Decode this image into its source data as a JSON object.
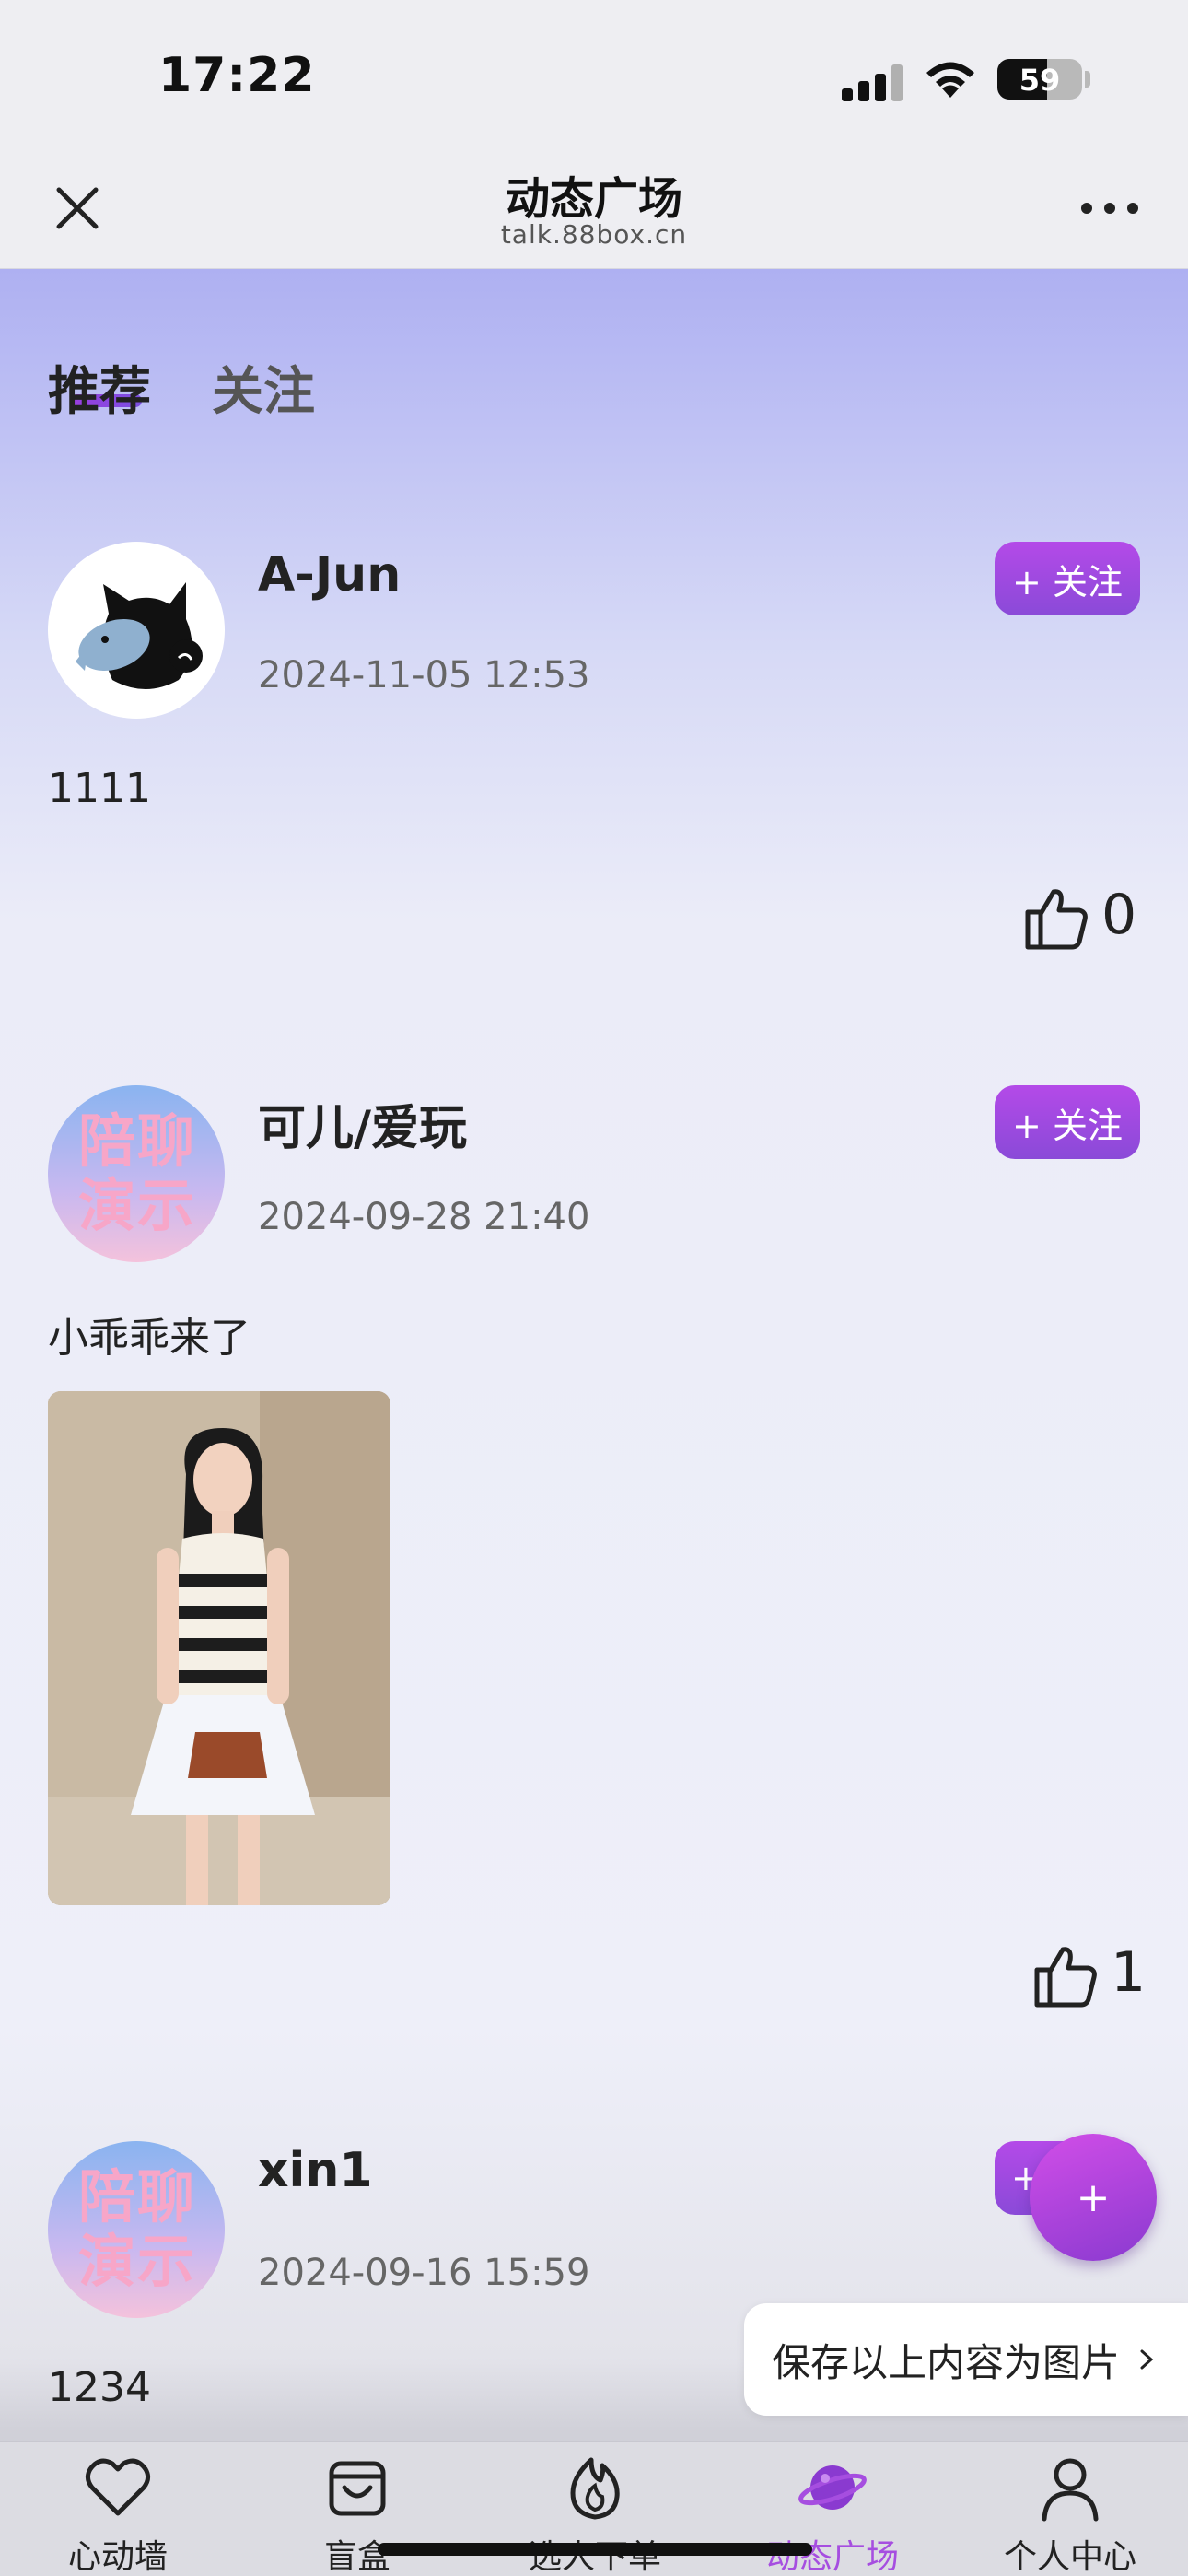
{
  "status_bar": {
    "time": "17:22",
    "battery": "59"
  },
  "nav": {
    "title": "动态广场",
    "subtitle": "talk.88box.cn"
  },
  "tabs": [
    {
      "label": "推荐",
      "active": true
    },
    {
      "label": "关注",
      "active": false
    }
  ],
  "posts": [
    {
      "username": "A-Jun",
      "time": "2024-11-05 12:53",
      "text": "1111",
      "likes": "0",
      "follow_label": "+ 关注",
      "avatar_icon": "cat-avatar-icon"
    },
    {
      "username": "可儿/爱玩",
      "time": "2024-09-28 21:40",
      "text": "小乖乖来了",
      "likes": "1",
      "follow_label": "+ 关注",
      "avatar_text": "陪聊演示",
      "has_photo": true
    },
    {
      "username": "xin1",
      "time": "2024-09-16 15:59",
      "text": "1234",
      "follow_label": "+",
      "avatar_text": "陪聊演示"
    }
  ],
  "fab": {
    "label": "+"
  },
  "save_tip": {
    "label": "保存以上内容为图片"
  },
  "bottom_tabs": [
    {
      "label": "心动墙",
      "icon": "heart-icon"
    },
    {
      "label": "盲盒",
      "icon": "bag-icon"
    },
    {
      "label": "选人下单",
      "icon": "flame-icon"
    },
    {
      "label": "动态广场",
      "icon": "planet-icon",
      "active": true
    },
    {
      "label": "个人中心",
      "icon": "person-icon"
    }
  ],
  "colors": {
    "accent": "#a64ee0",
    "follow_button": "#9a44dc"
  }
}
